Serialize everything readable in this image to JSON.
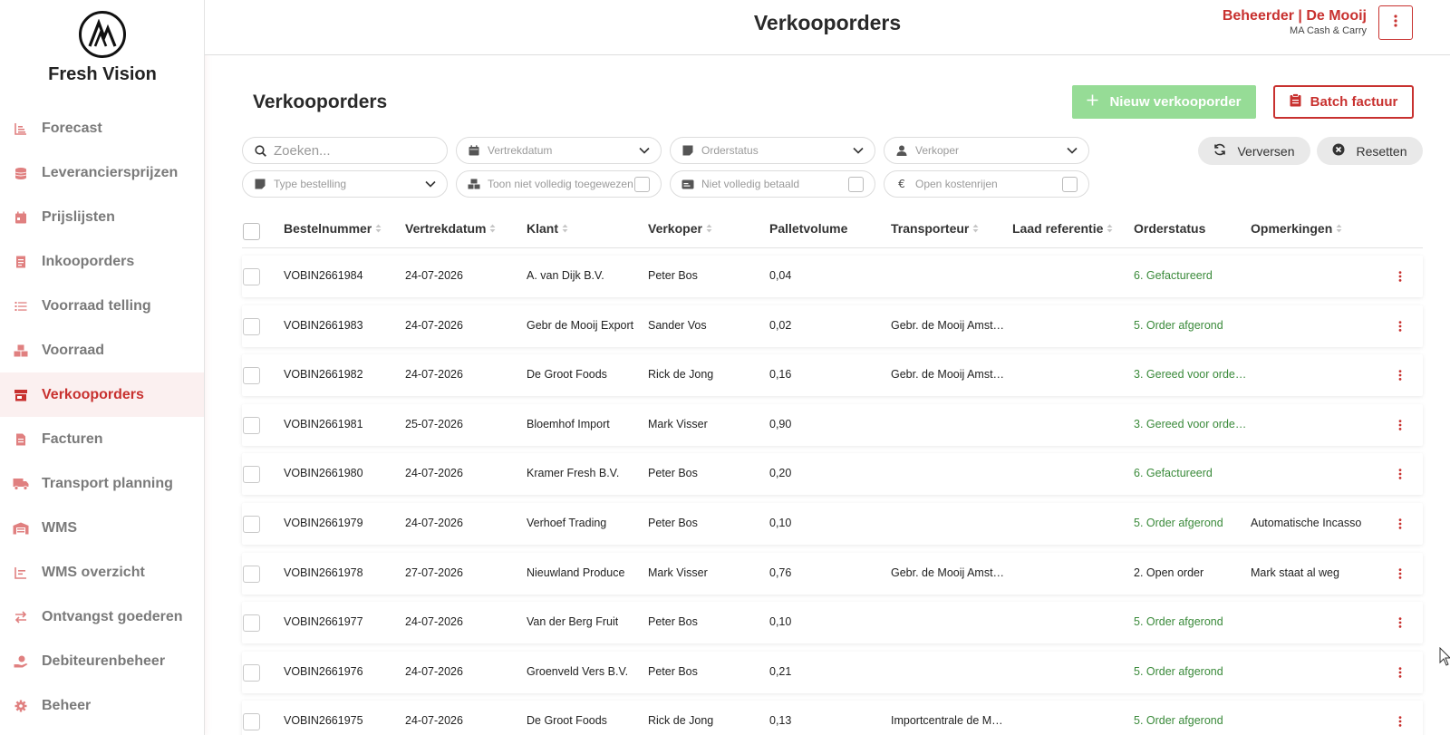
{
  "sidebar": {
    "brand": "Fresh Vision",
    "items": [
      {
        "label": "Forecast",
        "icon": "bar-chart-icon"
      },
      {
        "label": "Leveranciersprijzen",
        "icon": "coins-icon"
      },
      {
        "label": "Prijslijsten",
        "icon": "calendar-icon"
      },
      {
        "label": "Inkooporders",
        "icon": "receipt-icon"
      },
      {
        "label": "Voorraad telling",
        "icon": "list-icon"
      },
      {
        "label": "Voorraad",
        "icon": "boxes-icon"
      },
      {
        "label": "Verkooporders",
        "icon": "store-icon",
        "active": true
      },
      {
        "label": "Facturen",
        "icon": "invoice-icon"
      },
      {
        "label": "Transport planning",
        "icon": "truck-icon"
      },
      {
        "label": "WMS",
        "icon": "warehouse-icon"
      },
      {
        "label": "WMS overzicht",
        "icon": "chart-icon"
      },
      {
        "label": "Ontvangst goederen",
        "icon": "exchange-icon"
      },
      {
        "label": "Debiteurenbeheer",
        "icon": "hand-coin-icon"
      },
      {
        "label": "Beheer",
        "icon": "gear-icon"
      }
    ]
  },
  "header": {
    "title": "Verkooporders",
    "user_name": "Beheerder | De Mooij",
    "company": "MA Cash & Carry"
  },
  "main": {
    "title": "Verkooporders",
    "new_order_label": "Nieuw verkooporder",
    "batch_label": "Batch factuur",
    "refresh_label": "Verversen",
    "reset_label": "Resetten"
  },
  "filters": {
    "search_placeholder": "Zoeken...",
    "vertrekdatum": "Vertrekdatum",
    "orderstatus": "Orderstatus",
    "verkoper": "Verkoper",
    "type_bestelling": "Type bestelling",
    "toon_niet_toegewezen": "Toon niet volledig toegewezen",
    "niet_betaald": "Niet volledig betaald",
    "open_kostenrijen": "Open kostenrijen"
  },
  "table": {
    "columns": [
      "Bestelnummer",
      "Vertrekdatum",
      "Klant",
      "Verkoper",
      "Palletvolume",
      "Transporteur",
      "Laad referentie",
      "Orderstatus",
      "Opmerkingen"
    ],
    "rows": [
      {
        "nr": "VOBIN2661984",
        "date": "24-07-2026",
        "klant": "A. van Dijk B.V.",
        "verkoper": "Peter Bos",
        "volume": "0,04",
        "transporteur": "",
        "ref": "",
        "status": "6. Gefactureerd",
        "opm": ""
      },
      {
        "nr": "VOBIN2661983",
        "date": "24-07-2026",
        "klant": "Gebr de Mooij Export",
        "verkoper": "Sander Vos",
        "volume": "0,02",
        "transporteur": "Gebr. de Mooij Amst…",
        "ref": "",
        "status": "5. Order afgerond",
        "opm": ""
      },
      {
        "nr": "VOBIN2661982",
        "date": "24-07-2026",
        "klant": "De Groot Foods",
        "verkoper": "Rick de Jong",
        "volume": "0,16",
        "transporteur": "Gebr. de Mooij Amst…",
        "ref": "",
        "status": "3. Gereed voor orde…",
        "opm": ""
      },
      {
        "nr": "VOBIN2661981",
        "date": "25-07-2026",
        "klant": "Bloemhof Import",
        "verkoper": "Mark Visser",
        "volume": "0,90",
        "transporteur": "",
        "ref": "",
        "status": "3. Gereed voor orde…",
        "opm": ""
      },
      {
        "nr": "VOBIN2661980",
        "date": "24-07-2026",
        "klant": "Kramer Fresh B.V.",
        "verkoper": "Peter Bos",
        "volume": "0,20",
        "transporteur": "",
        "ref": "",
        "status": "6. Gefactureerd",
        "opm": ""
      },
      {
        "nr": "VOBIN2661979",
        "date": "24-07-2026",
        "klant": "Verhoef Trading",
        "verkoper": "Peter Bos",
        "volume": "0,10",
        "transporteur": "",
        "ref": "",
        "status": "5. Order afgerond",
        "opm": "Automatische Incasso"
      },
      {
        "nr": "VOBIN2661978",
        "date": "27-07-2026",
        "klant": "Nieuwland Produce",
        "verkoper": "Mark Visser",
        "volume": "0,76",
        "transporteur": "Gebr. de Mooij Amst…",
        "ref": "",
        "status": "2. Open order",
        "opm": "Mark staat al weg"
      },
      {
        "nr": "VOBIN2661977",
        "date": "24-07-2026",
        "klant": "Van der Berg Fruit",
        "verkoper": "Peter Bos",
        "volume": "0,10",
        "transporteur": "",
        "ref": "",
        "status": "5. Order afgerond",
        "opm": ""
      },
      {
        "nr": "VOBIN2661976",
        "date": "24-07-2026",
        "klant": "Groenveld Vers B.V.",
        "verkoper": "Peter Bos",
        "volume": "0,21",
        "transporteur": "",
        "ref": "",
        "status": "5. Order afgerond",
        "opm": ""
      },
      {
        "nr": "VOBIN2661975",
        "date": "24-07-2026",
        "klant": "De Groot Foods",
        "verkoper": "Rick de Jong",
        "volume": "0,13",
        "transporteur": "Importcentrale de M…",
        "ref": "",
        "status": "5. Order afgerond",
        "opm": ""
      }
    ]
  },
  "colors": {
    "accent": "#c8312f",
    "green_button": "#96dc96",
    "status_green": "#3a8a3a"
  }
}
